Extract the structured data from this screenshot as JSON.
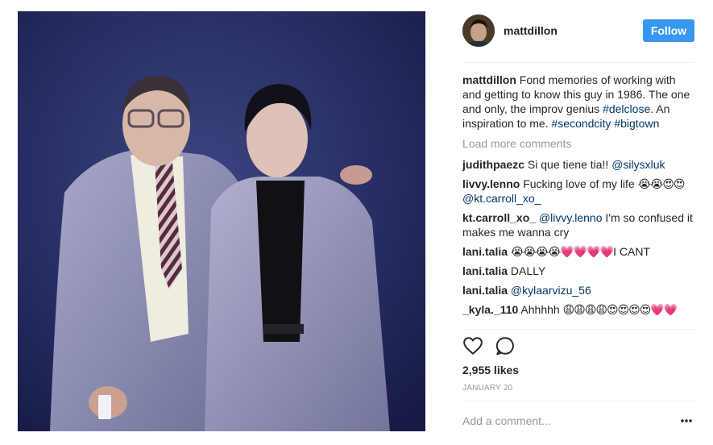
{
  "post": {
    "username": "mattdillon",
    "follow_label": "Follow",
    "caption": {
      "user": "mattdillon",
      "text": " Fond memories of working with and getting to know this guy in 1986. The one and only, the improv genius ",
      "tag1": "#delclose",
      "text2": ". An inspiration to me. ",
      "tag2": "#secondcity",
      "tag3": "#bigtown"
    },
    "load_more": "Load more comments",
    "comments": [
      {
        "user": "judithpaezc",
        "text": " Si que tiene tia!! ",
        "mention": "@silysxluk"
      },
      {
        "user": "livvy.lenno",
        "text": " Fucking love of my life ",
        "emoji": "😭😭😍😍",
        "mention": "@kt.carroll_xo_"
      },
      {
        "user": "kt.carroll_xo_",
        "mention": "@livvy.lenno",
        "text": " I'm so confused it makes me wanna cry"
      },
      {
        "user": "lani.talia",
        "emoji": "😭😭😭😭💗💗💗💗",
        "text": "I CANT"
      },
      {
        "user": "lani.talia",
        "text": " DALLY"
      },
      {
        "user": "lani.talia",
        "mention": "@kylaarvizu_56"
      },
      {
        "user": "_kyla._110",
        "text": " Ahhhhh ",
        "emoji": "😩😩😩😩😍😍😍😍💗💗"
      }
    ],
    "likes": "2,955 likes",
    "date": "JANUARY 20",
    "add_comment_placeholder": "Add a comment...",
    "icons": {
      "like": "heart-outline-icon",
      "comment": "speech-bubble-icon",
      "more": "more-dots-icon"
    },
    "colors": {
      "follow_button": "#3897f0",
      "hashtag": "#003569",
      "muted": "#999999"
    }
  }
}
